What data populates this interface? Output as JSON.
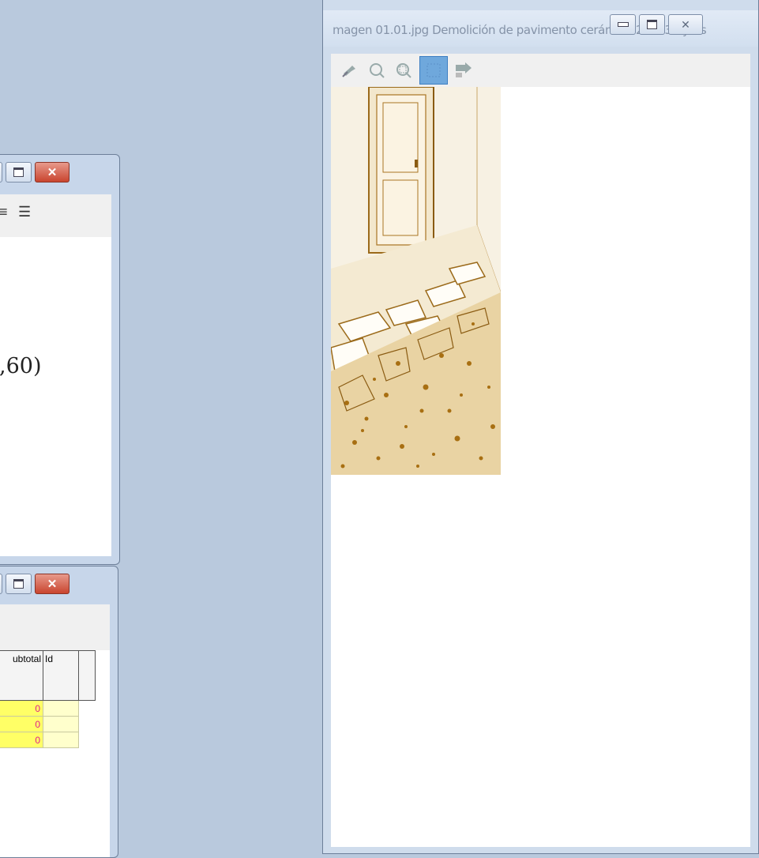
{
  "image_window": {
    "title": "magen 01.01.jpg Demolición de pavimento cerámico 20643 bytes",
    "toolbar_icons": [
      "pin-icon",
      "zoom-out-icon",
      "zoom-fit-icon",
      "select-area-icon",
      "export-icon"
    ]
  },
  "text_window": {
    "formula_text": ",60)"
  },
  "table_window": {
    "columns": [
      "ubtotal",
      "Id"
    ],
    "rows": [
      {
        "subtotal": "0",
        "id": ""
      },
      {
        "subtotal": "0",
        "id": ""
      },
      {
        "subtotal": "0",
        "id": ""
      }
    ]
  },
  "colors": {
    "desktop": "#b9c9dd",
    "close_button": "#c9442e",
    "selected_tool": "#6fa8dc",
    "subtotal_cell": "#ffff66",
    "subtotal_text": "#e0208a"
  }
}
